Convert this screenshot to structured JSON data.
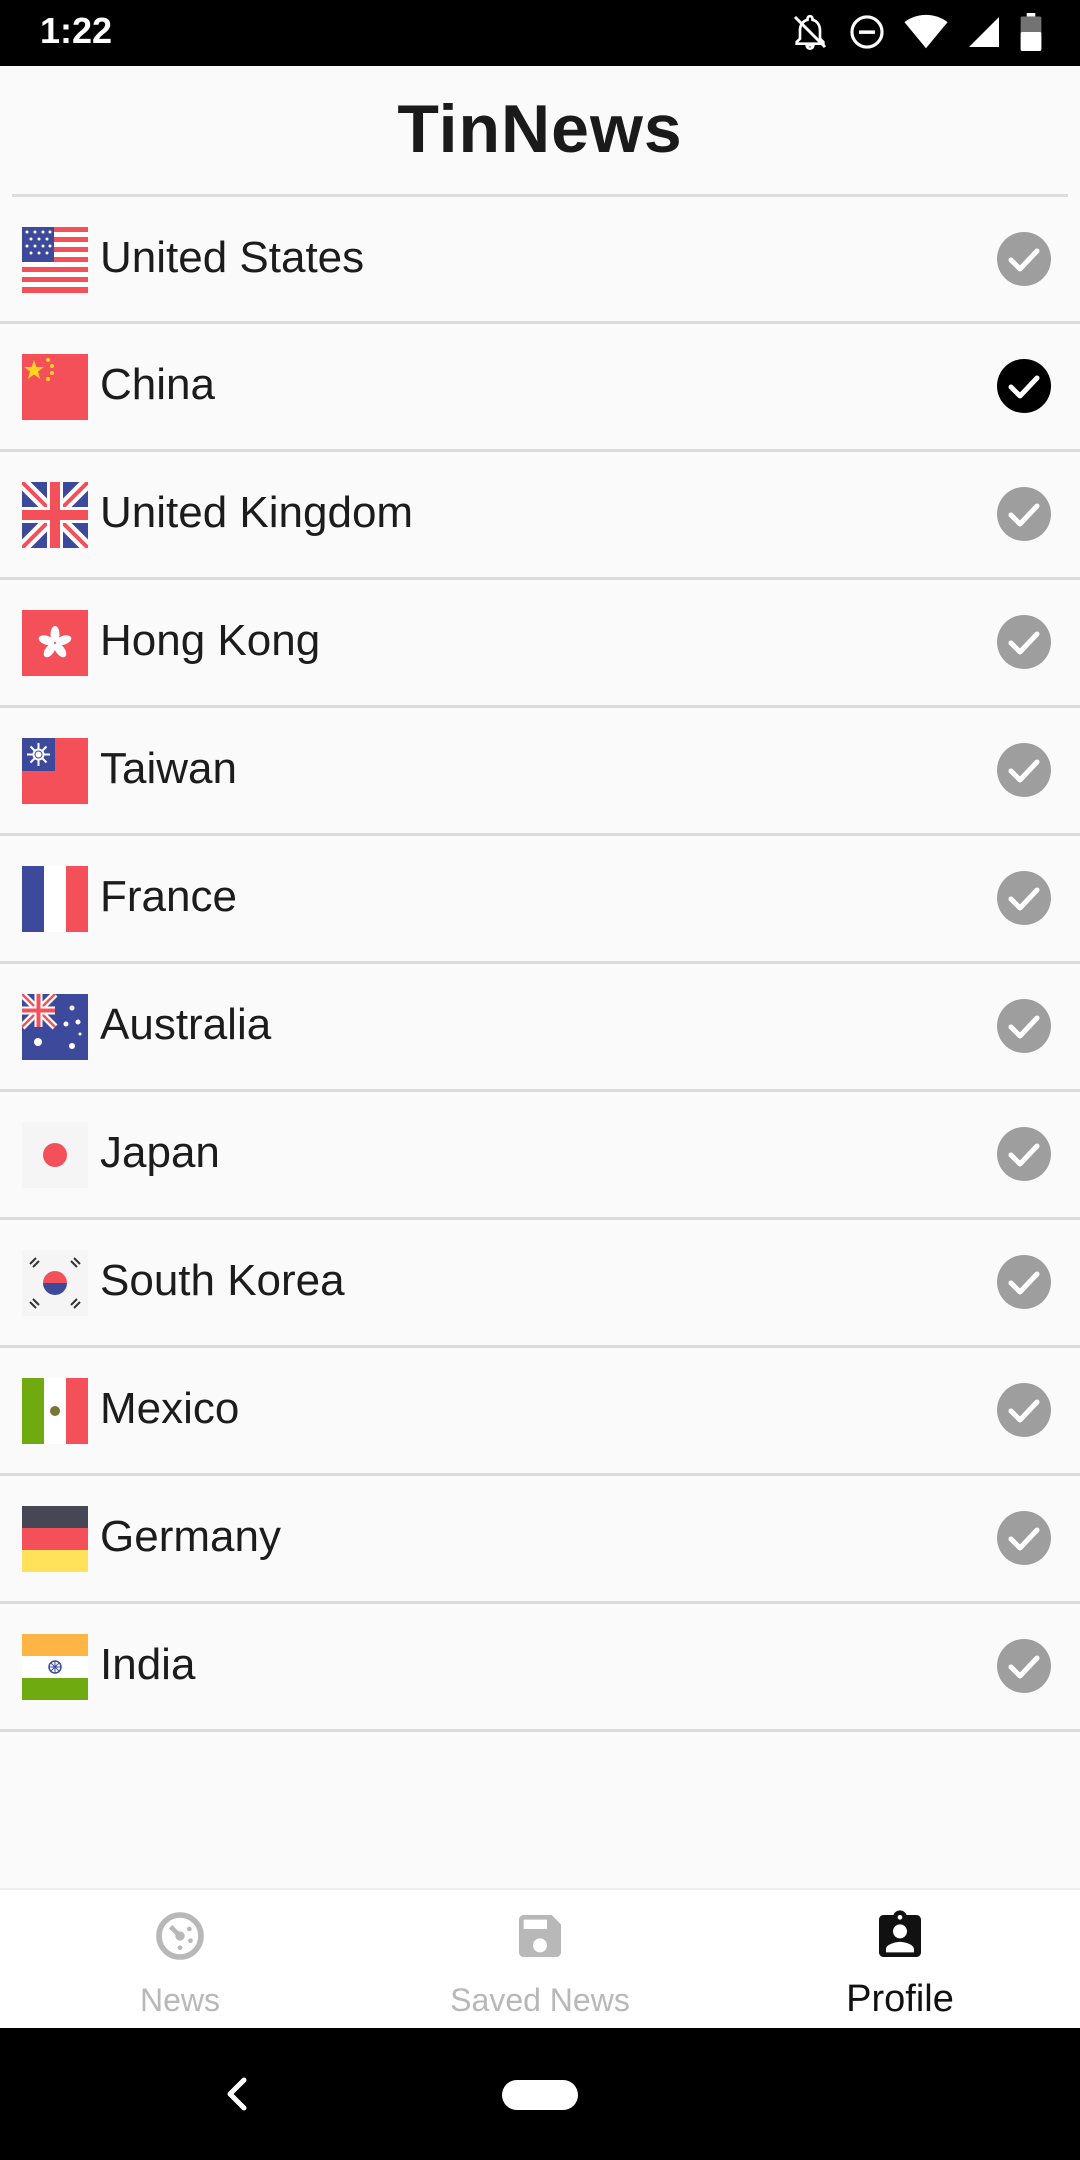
{
  "status": {
    "time": "1:22"
  },
  "app": {
    "title": "TinNews"
  },
  "countries": [
    {
      "name": "United States",
      "flag": "us-flag",
      "selected": false
    },
    {
      "name": "China",
      "flag": "cn-flag",
      "selected": true
    },
    {
      "name": "United Kingdom",
      "flag": "gb-flag",
      "selected": false
    },
    {
      "name": "Hong Kong",
      "flag": "hk-flag",
      "selected": false
    },
    {
      "name": "Taiwan",
      "flag": "tw-flag",
      "selected": false
    },
    {
      "name": "France",
      "flag": "fr-flag",
      "selected": false
    },
    {
      "name": "Australia",
      "flag": "au-flag",
      "selected": false
    },
    {
      "name": "Japan",
      "flag": "jp-flag",
      "selected": false
    },
    {
      "name": "South Korea",
      "flag": "kr-flag",
      "selected": false
    },
    {
      "name": "Mexico",
      "flag": "mx-flag",
      "selected": false
    },
    {
      "name": "Germany",
      "flag": "de-flag",
      "selected": false
    },
    {
      "name": "India",
      "flag": "in-flag",
      "selected": false
    }
  ],
  "bottom_nav": {
    "news_label": "News",
    "saved_label": "Saved News",
    "profile_label": "Profile",
    "active": "Profile"
  },
  "colors": {
    "check_inactive": "#9e9e9e",
    "check_active": "#000000",
    "nav_inactive": "#b8b8b8",
    "nav_active": "#111111"
  }
}
